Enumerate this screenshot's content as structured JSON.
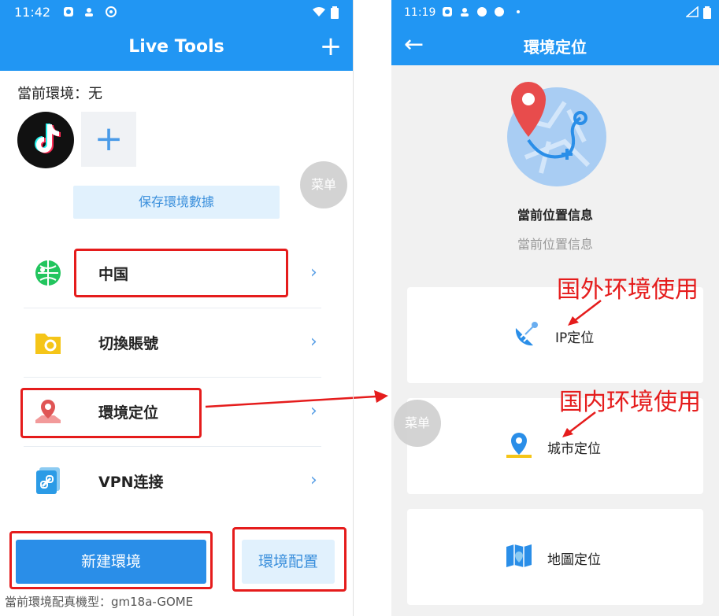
{
  "left_screen": {
    "status": {
      "time": "11:42"
    },
    "title": "Live Tools",
    "plus_label": "+",
    "current_env_label": "當前環境：无",
    "add_label": "+",
    "menu_float_label": "菜单",
    "save_button": "保存環境數據",
    "rows": [
      {
        "label": "中国",
        "icon": "globe-icon"
      },
      {
        "label": "切換賬號",
        "icon": "folder-icon"
      },
      {
        "label": "環境定位",
        "icon": "map-pin-icon"
      },
      {
        "label": "VPN连接",
        "icon": "link-icon"
      }
    ],
    "chevron": "›",
    "new_env_button": "新建環境",
    "env_config_button": "環境配置",
    "footer": "當前環境配真機型：gm18a-GOME"
  },
  "right_screen": {
    "status": {
      "time": "11:19"
    },
    "title": "環境定位",
    "back_label": "←",
    "location_title": "當前位置信息",
    "location_subtitle": "當前位置信息",
    "menu_float_label": "菜单",
    "options": [
      {
        "label": "IP定位",
        "icon": "satellite-dish-icon"
      },
      {
        "label": "城市定位",
        "icon": "city-pin-icon"
      },
      {
        "label": "地圖定位",
        "icon": "map-icon"
      }
    ]
  },
  "annotations": {
    "overseas": "国外环境使用",
    "domestic": "国内环境使用"
  },
  "colors": {
    "primary": "#2196f3",
    "highlight": "#e51c1c",
    "light_button_bg": "#e1f1fd"
  }
}
